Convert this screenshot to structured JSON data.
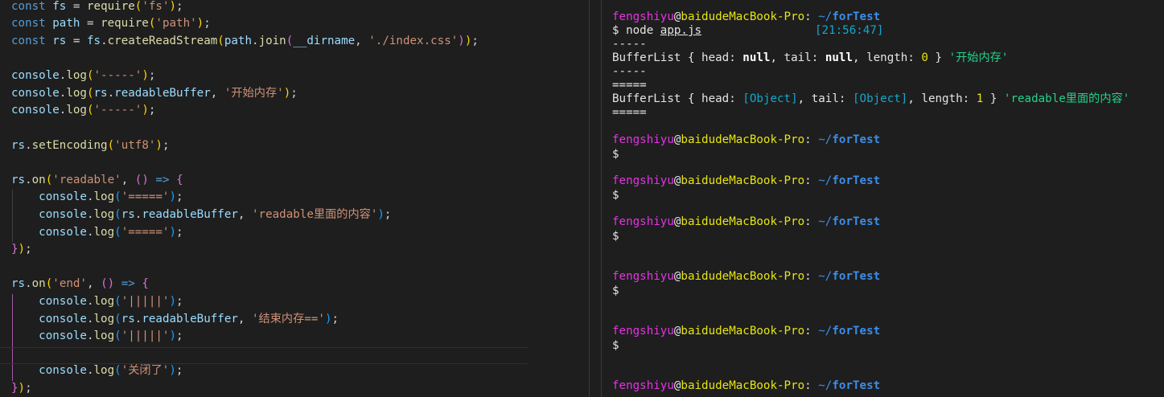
{
  "editor": {
    "lines": [
      "const fs = require('fs');",
      "const path = require('path');",
      "const rs = fs.createReadStream(path.join(__dirname, './index.css'));",
      "",
      "console.log('-----');",
      "console.log(rs.readableBuffer, '开始内存');",
      "console.log('-----');",
      "",
      "rs.setEncoding('utf8');",
      "",
      "rs.on('readable', () => {",
      "    console.log('=====');",
      "    console.log(rs.readableBuffer, 'readable里面的内容');",
      "    console.log('=====');",
      "});",
      "",
      "rs.on('end', () => {",
      "    console.log('|||||');",
      "    console.log(rs.readableBuffer, '结束内存==');",
      "    console.log('|||||');",
      "",
      "    console.log('关闭了');",
      "});"
    ]
  },
  "terminal": {
    "user": "fengshiyu",
    "at": "@",
    "host": "baidudeMacBook-Pro",
    "sep": ": ",
    "path_tilde": "~/",
    "path_dir": "forTest",
    "prompt": "$",
    "command_prefix": " node ",
    "command_file": "app.js",
    "timestamp": "[21:56:47]",
    "dash_line": "-----",
    "buffer1": {
      "prefix": "BufferList { head: ",
      "head": "null",
      "mid": ", tail: ",
      "tail": "null",
      "mid2": ", length: ",
      "length": "0",
      "suffix": " } ",
      "label": "'开始内存'"
    },
    "eq_line": "=====",
    "buffer2": {
      "prefix": "BufferList { head: ",
      "head": "[Object]",
      "mid": ", tail: ",
      "tail": "[Object]",
      "mid2": ", length: ",
      "length": "1",
      "suffix": " } ",
      "label": "'readable里面的内容'"
    }
  },
  "colors": {
    "background": "#1e1e1e",
    "keyword": "#569cd6",
    "string": "#ce9178",
    "function": "#dcdcaa",
    "variable": "#9cdcfe",
    "term_user": "#e533e5",
    "term_host": "#e5e510",
    "term_path": "#3b8eea"
  }
}
